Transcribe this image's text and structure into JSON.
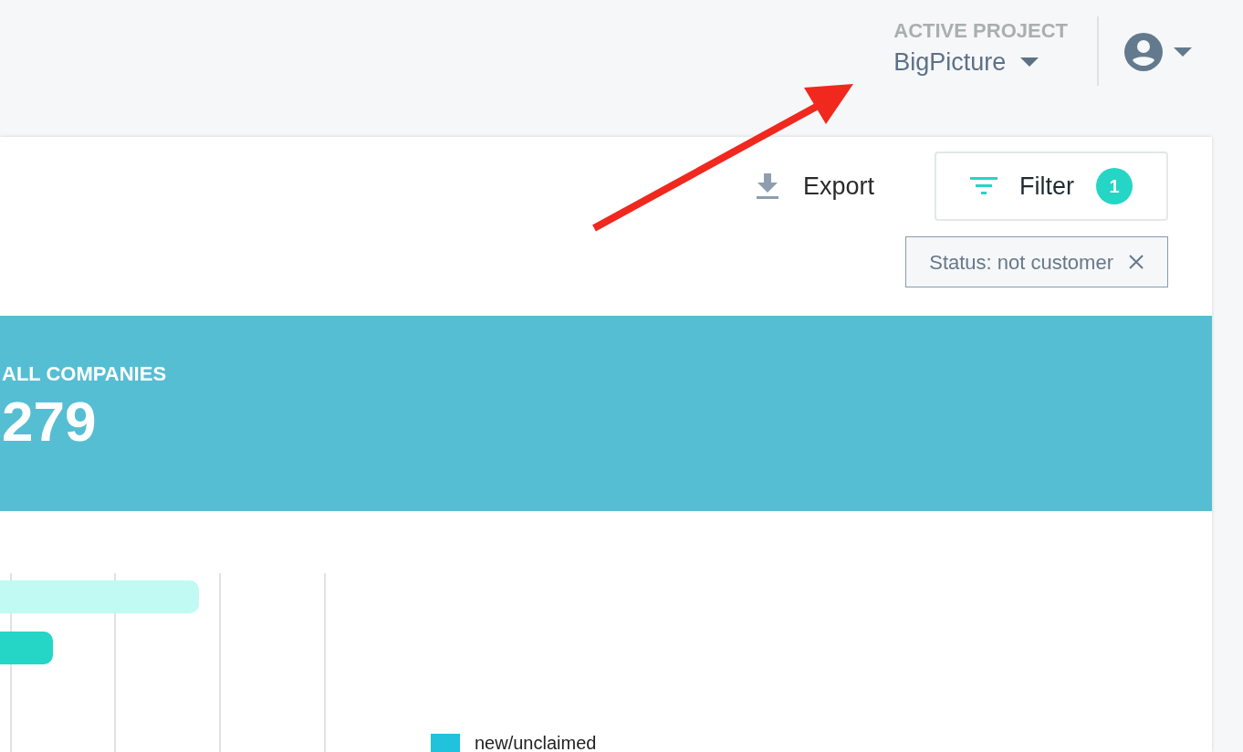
{
  "header": {
    "project_label": "ACTIVE PROJECT",
    "project_name": "BigPicture"
  },
  "toolbar": {
    "export_label": "Export",
    "filter_label": "Filter",
    "filter_count": "1"
  },
  "filter_chips": [
    {
      "label": "Status: not customer"
    }
  ],
  "banner": {
    "label": "ALL COMPANIES",
    "value": "279"
  },
  "legend": [
    {
      "label": "new/unclaimed",
      "color": "#20c2dc"
    }
  ]
}
